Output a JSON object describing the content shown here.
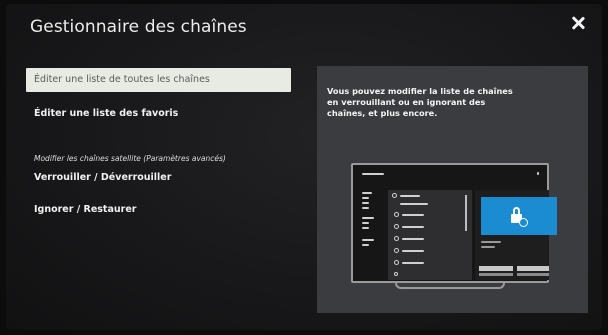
{
  "header": {
    "title": "Gestionnaire des chaînes",
    "close_icon": "close-icon"
  },
  "menu": {
    "items": [
      {
        "label": "Éditer une liste de toutes les chaînes",
        "selected": true
      },
      {
        "label": "Éditer une liste des favoris",
        "selected": false
      }
    ],
    "section_label": "Modifier les chaînes satellite (Paramètres avancés)",
    "satellite_items": [
      {
        "label": "Verrouiller / Déverrouiller"
      },
      {
        "label": "Ignorer / Restaurer"
      }
    ]
  },
  "info": {
    "description": "Vous pouvez modifier la liste de chaînes en verrouillant ou en ignorant des chaînes, et plus encore.",
    "illustration_icon": "tv-lock-illustration-icon"
  },
  "colors": {
    "background": "#18181a",
    "selected_item": "#e8ebe4",
    "info_panel": "#3b3c40",
    "accent": "#1c8cd2"
  }
}
